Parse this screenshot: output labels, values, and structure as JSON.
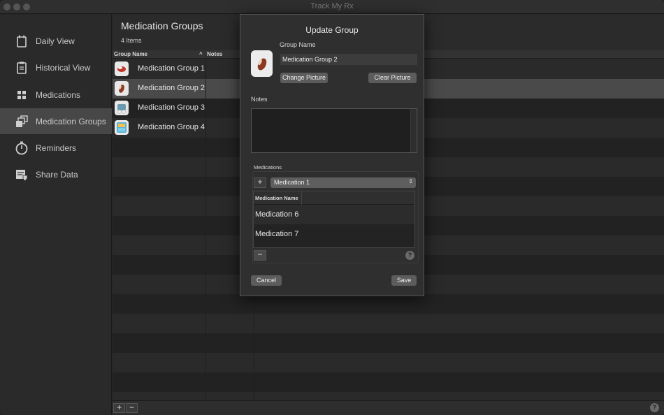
{
  "window": {
    "title": "Track My Rx"
  },
  "sidebar": {
    "items": [
      {
        "label": "Daily View",
        "icon": "calendar-icon"
      },
      {
        "label": "Historical View",
        "icon": "clipboard-icon"
      },
      {
        "label": "Medications",
        "icon": "grid-icon"
      },
      {
        "label": "Medication Groups",
        "icon": "stacked-windows-icon",
        "active": true
      },
      {
        "label": "Reminders",
        "icon": "stopwatch-icon"
      },
      {
        "label": "Share Data",
        "icon": "shield-document-icon"
      }
    ]
  },
  "main": {
    "title": "Medication Groups",
    "count": "4 Items",
    "columns": {
      "group_name": "Group Name",
      "sort_indicator": "^",
      "notes": "Notes"
    },
    "rows": [
      {
        "name": "Medication Group 1"
      },
      {
        "name": "Medication Group 2",
        "selected": true
      },
      {
        "name": "Medication Group 3"
      },
      {
        "name": "Medication Group 4"
      }
    ],
    "add_label": "+",
    "remove_label": "−",
    "help_label": "?"
  },
  "dialog": {
    "title": "Update Group",
    "group_name_label": "Group Name",
    "group_name_value": "Medication Group 2",
    "change_picture": "Change Picture",
    "clear_picture": "Clear Picture",
    "notes_label": "Notes",
    "notes_value": "",
    "medications_label": "Medications",
    "add_label": "+",
    "selected_medication": "Medication 1",
    "med_column": "Medication Name",
    "meds": [
      "Medication 6",
      "Medication 7"
    ],
    "remove_label": "−",
    "help_label": "?",
    "cancel": "Cancel",
    "save": "Save"
  }
}
